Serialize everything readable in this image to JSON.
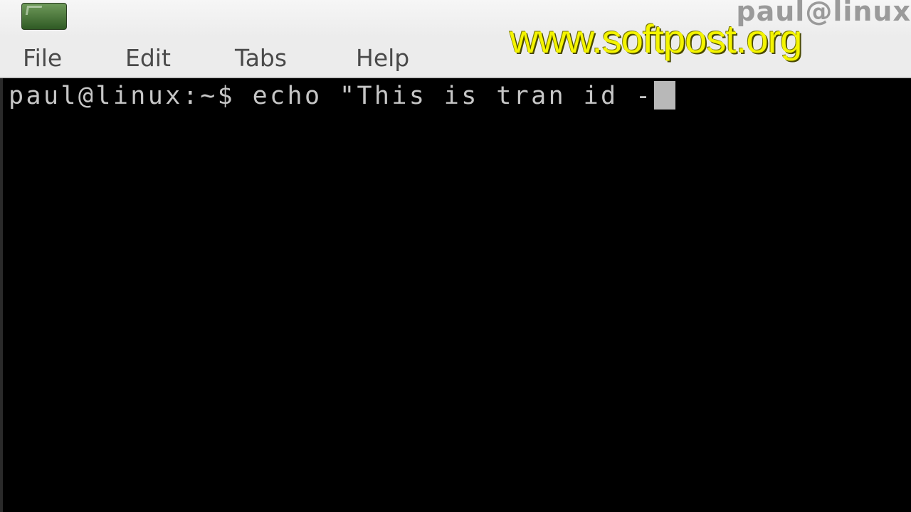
{
  "window": {
    "title": "paul@linux"
  },
  "menubar": {
    "items": [
      {
        "label": "File"
      },
      {
        "label": "Edit"
      },
      {
        "label": "Tabs"
      },
      {
        "label": "Help"
      }
    ]
  },
  "watermark": {
    "text": "www.softpost.org",
    "color": "#f4f400"
  },
  "terminal": {
    "prompt": "paul@linux:~$ ",
    "command": "echo \"This is tran id -",
    "text_color": "#c6c6c6",
    "background_color": "#000000"
  },
  "icons": {
    "app": "terminal-app-icon",
    "cursor": "block-cursor"
  }
}
